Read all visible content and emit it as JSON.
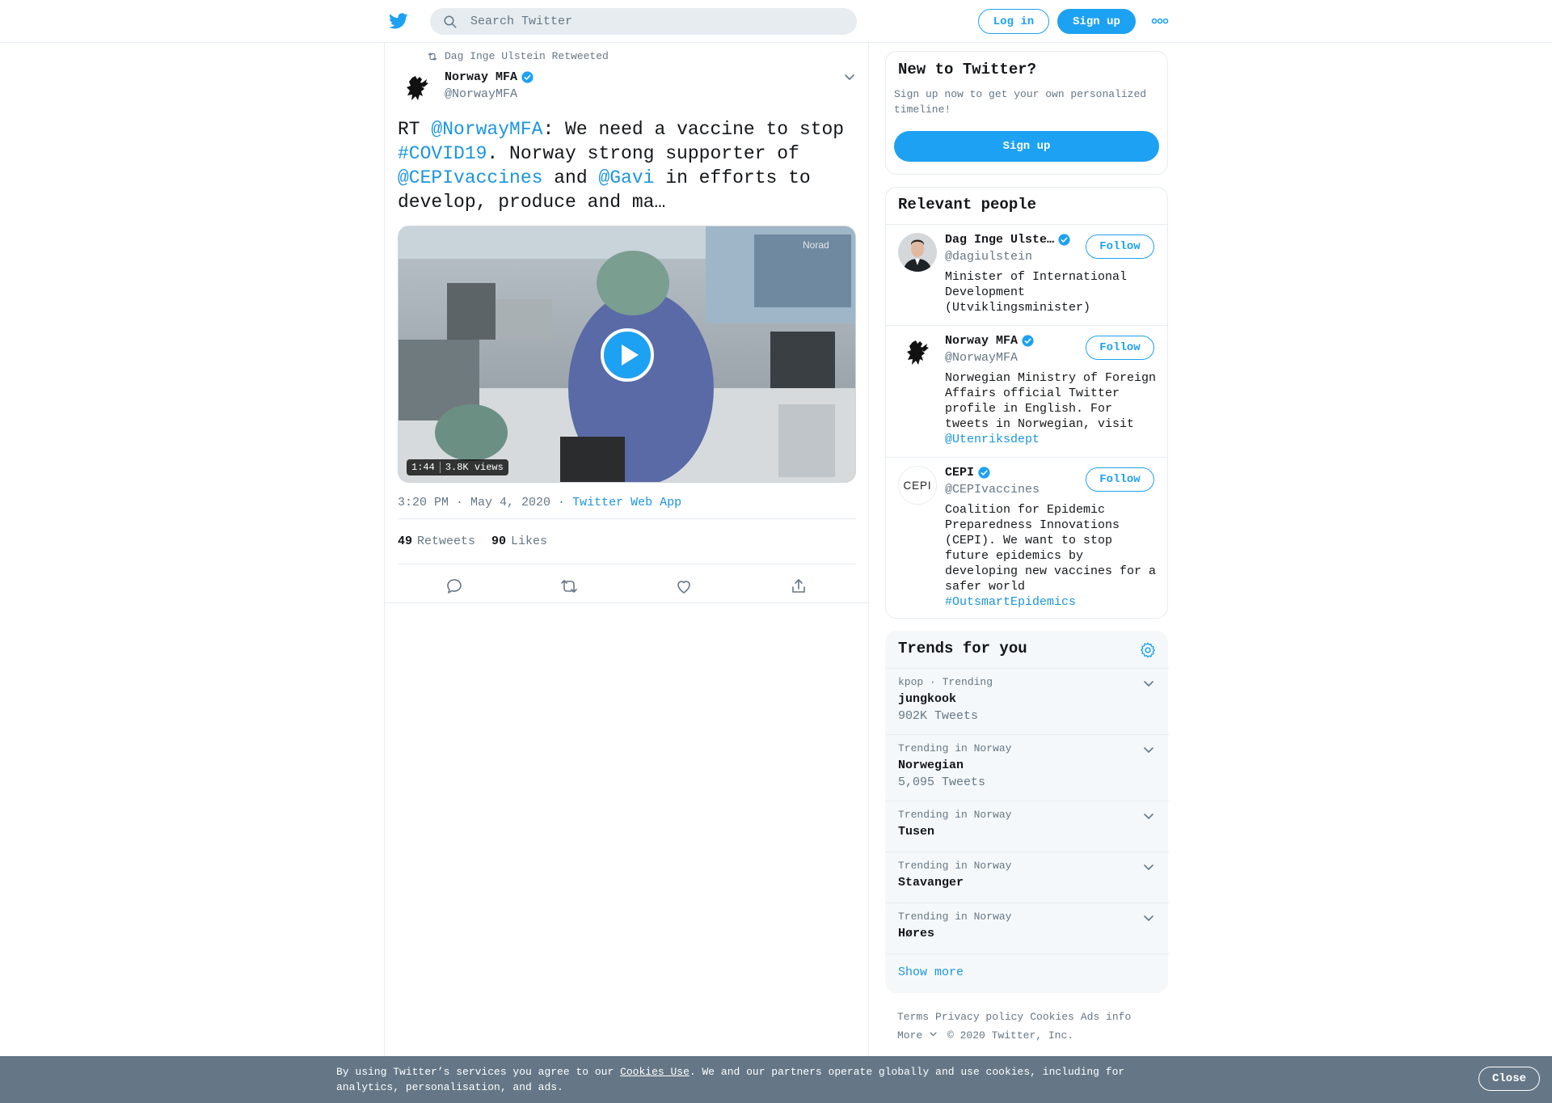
{
  "header": {
    "search_placeholder": "Search Twitter",
    "login_label": "Log in",
    "signup_label": "Sign up"
  },
  "tweet": {
    "retweeted_by": "Dag Inge Ulstein Retweeted",
    "author_name": "Norway MFA",
    "author_handle": "@NorwayMFA",
    "text_parts": {
      "p1": "RT ",
      "m1": "@NorwayMFA",
      "p2": ": We need a vaccine to stop ",
      "h1": "#COVID19",
      "p3": ". Norway strong supporter of ",
      "m2": "@CEPIvaccines",
      "p4": " and ",
      "m3": "@Gavi",
      "p5": " in efforts to develop, produce and ma…"
    },
    "video_duration": "1:44",
    "video_views": "3.8K views",
    "video_watermark": "Norad",
    "timestamp": "3:20 PM · May 4, 2020",
    "source": "Twitter Web App",
    "retweets_count": "49",
    "retweets_label": "Retweets",
    "likes_count": "90",
    "likes_label": "Likes"
  },
  "new_to_twitter": {
    "title": "New to Twitter?",
    "description": "Sign up now to get your own personalized timeline!",
    "signup_label": "Sign up"
  },
  "relevant_people": {
    "title": "Relevant people",
    "people": [
      {
        "name": "Dag Inge Ulste…",
        "handle": "@dagiulstein",
        "bio": "Minister of International Development (Utviklingsminister)",
        "follow_label": "Follow"
      },
      {
        "name": "Norway MFA",
        "handle": "@NorwayMFA",
        "bio": "Norwegian Ministry of Foreign Affairs official Twitter profile in English. For tweets in Norwegian, visit ",
        "bio_link": "@Utenriksdept",
        "follow_label": "Follow"
      },
      {
        "name": "CEPI",
        "handle": "@CEPIvaccines",
        "bio": "Coalition for Epidemic Preparedness Innovations (CEPI). We want to stop future epidemics by developing new vaccines for a safer world ",
        "bio_link": "#OutsmartEpidemics",
        "avatar_text": "CEPI",
        "follow_label": "Follow"
      }
    ]
  },
  "trends": {
    "title": "Trends for you",
    "items": [
      {
        "meta": "kpop · Trending",
        "name": "jungkook",
        "count": "902K Tweets"
      },
      {
        "meta": "Trending in Norway",
        "name": "Norwegian",
        "count": "5,095 Tweets"
      },
      {
        "meta": "Trending in Norway",
        "name": "Tusen",
        "count": ""
      },
      {
        "meta": "Trending in Norway",
        "name": "Stavanger",
        "count": ""
      },
      {
        "meta": "Trending in Norway",
        "name": "Høres",
        "count": ""
      }
    ],
    "show_more": "Show more"
  },
  "footer": {
    "terms": "Terms",
    "privacy": "Privacy policy",
    "cookies": "Cookies",
    "ads_info": "Ads info",
    "more": "More",
    "copyright": "© 2020 Twitter, Inc."
  },
  "cookie_banner": {
    "text_before": "By using Twitter’s services you agree to our ",
    "link": "Cookies Use",
    "text_after": ". We and our partners operate globally and use cookies, including for analytics, personalisation, and ads.",
    "close_label": "Close"
  },
  "colors": {
    "accent": "#1da1f2",
    "link": "#1b95e0",
    "muted": "#657786",
    "banner": "#657786"
  }
}
